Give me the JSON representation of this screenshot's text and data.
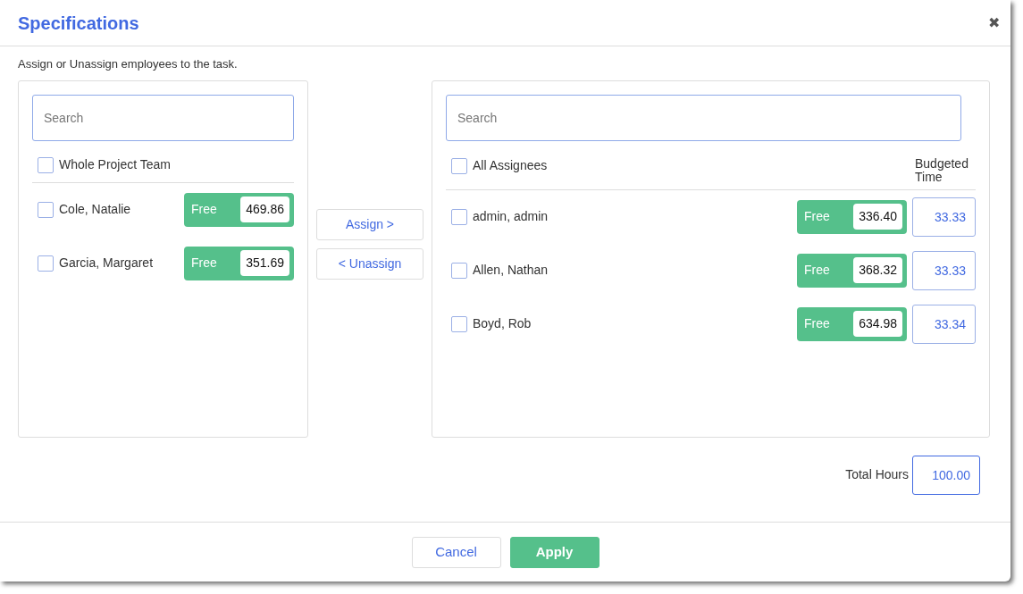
{
  "dialog": {
    "title": "Specifications",
    "close": "✖",
    "description": "Assign or Unassign employees to the task."
  },
  "available": {
    "search": {
      "placeholder": "Search"
    },
    "select_all": {
      "label": "Whole Project Team",
      "checked": false
    },
    "employees": [
      {
        "name": "Cole, Natalie",
        "checked": false,
        "status": "Free",
        "hours": "469.86"
      },
      {
        "name": "Garcia, Margaret",
        "checked": false,
        "status": "Free",
        "hours": "351.69"
      }
    ]
  },
  "transfer_buttons": [
    "Assign >",
    "< Unassign"
  ],
  "assigned": {
    "search": {
      "placeholder": "Search"
    },
    "select_all": {
      "label": "All Assignees",
      "checked": false
    },
    "budget_header": "Budgeted Time",
    "employees": [
      {
        "name": "admin, admin",
        "checked": false,
        "status": "Free",
        "hours": "336.40",
        "budgeted": "33.33"
      },
      {
        "name": "Allen, Nathan",
        "checked": false,
        "status": "Free",
        "hours": "368.32",
        "budgeted": "33.33"
      },
      {
        "name": "Boyd, Rob",
        "checked": false,
        "status": "Free",
        "hours": "634.98",
        "budgeted": "33.34"
      }
    ]
  },
  "total": {
    "label": "Total Hours",
    "value": "100.00"
  },
  "footer_buttons": [
    {
      "label": "Cancel",
      "kind": "secondary"
    },
    {
      "label": "Apply",
      "kind": "primary"
    }
  ]
}
